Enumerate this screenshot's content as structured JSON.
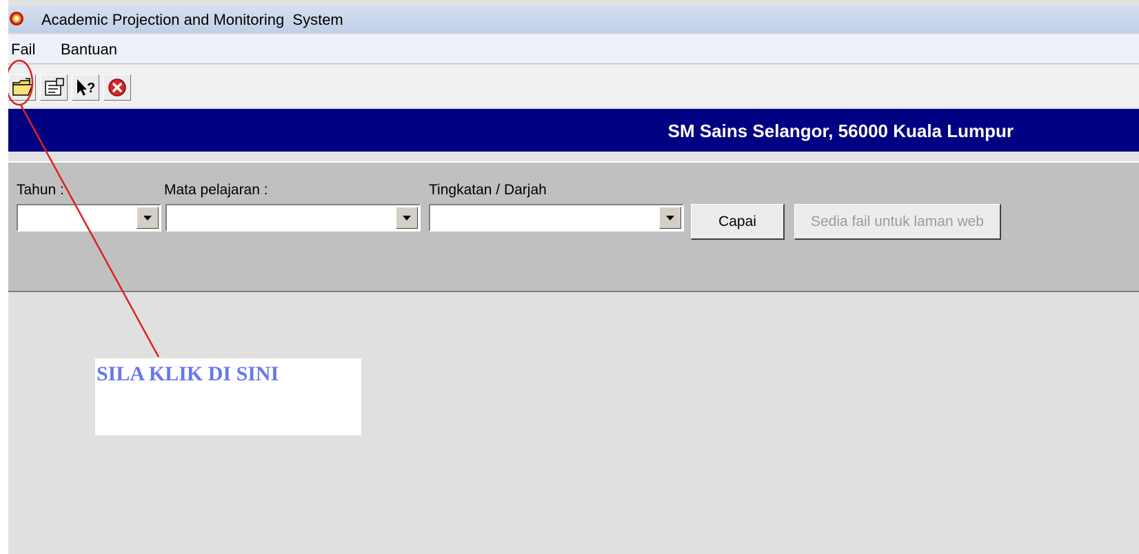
{
  "window": {
    "title": "Academic Projection and Monitoring  System"
  },
  "menubar": {
    "items": [
      {
        "label": "Fail"
      },
      {
        "label": "Bantuan"
      }
    ]
  },
  "toolbar": {
    "buttons": [
      {
        "icon": "open-folder-icon"
      },
      {
        "icon": "properties-icon"
      },
      {
        "icon": "help-pointer-icon"
      },
      {
        "icon": "close-icon"
      }
    ]
  },
  "banner": {
    "school": "SM Sains Selangor, 56000 Kuala Lumpur"
  },
  "filters": {
    "tahun": {
      "label": "Tahun :",
      "value": ""
    },
    "mata_pelajaran": {
      "label": "Mata pelajaran :",
      "value": ""
    },
    "tingkatan": {
      "label": "Tingkatan / Darjah",
      "value": ""
    },
    "capai_label": "Capai",
    "web_label": "Sedia fail untuk laman web"
  },
  "annotation": {
    "text": "SILA KLIK DI SINI",
    "color": "#6677f0",
    "line_color": "#e02020"
  },
  "colors": {
    "banner": "#000082",
    "panel": "#c0c0c0",
    "workspace": "#e0e0e0"
  }
}
